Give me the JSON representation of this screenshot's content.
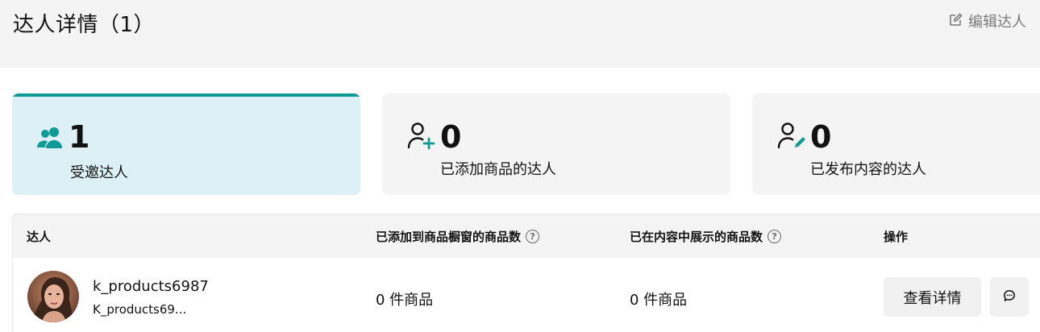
{
  "header": {
    "title": "达人详情（1）",
    "edit_label": "编辑达人"
  },
  "stats": [
    {
      "value": "1",
      "label": "受邀达人",
      "icon": "users-icon",
      "active": true
    },
    {
      "value": "0",
      "label": "已添加商品的达人",
      "icon": "user-plus-icon",
      "active": false
    },
    {
      "value": "0",
      "label": "已发布内容的达人",
      "icon": "user-edit-icon",
      "active": false
    }
  ],
  "table": {
    "columns": [
      "达人",
      "已添加到商品橱窗的商品数",
      "已在内容中展示的商品数",
      "操作"
    ],
    "help_glyph": "?",
    "rows": [
      {
        "name": "k_products6987",
        "handle": "K_products69...",
        "showcase_count": "0 件商品",
        "content_count": "0 件商品",
        "detail_button": "查看详情"
      }
    ]
  },
  "colors": {
    "accent": "#0e9a95",
    "active_card_bg": "#dcf0f5",
    "header_bg": "#f4f4f4"
  }
}
